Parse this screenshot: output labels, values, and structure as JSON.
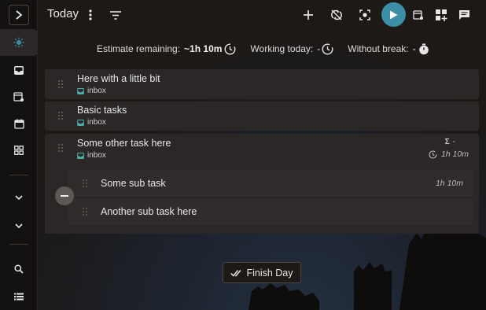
{
  "header": {
    "title": "Today",
    "icons": [
      "more-vertical-icon",
      "filter-icon",
      "add-icon",
      "sync-disabled-icon",
      "focus-mode-icon",
      "play-icon",
      "schedule-icon",
      "add-widget-icon",
      "notes-icon"
    ],
    "accent_color": "#3b8ea5"
  },
  "sidebar": {
    "items": [
      {
        "name": "today",
        "icon": "sun-icon",
        "active": true
      },
      {
        "name": "inbox",
        "icon": "inbox-icon"
      },
      {
        "name": "schedule",
        "icon": "calendar-sun-icon"
      },
      {
        "name": "planner",
        "icon": "calendar-icon"
      },
      {
        "name": "boards",
        "icon": "grid-icon"
      },
      {
        "name": "projects",
        "icon": "chevron-down-icon"
      },
      {
        "name": "tags",
        "icon": "chevron-down-icon"
      },
      {
        "name": "search",
        "icon": "search-icon"
      },
      {
        "name": "all-tasks",
        "icon": "list-icon"
      }
    ]
  },
  "metrics": {
    "estimate_label": "Estimate remaining:",
    "estimate_value": "~1h 10m",
    "working_label": "Working today:",
    "working_value": "-",
    "break_label": "Without break:",
    "break_value": "-"
  },
  "tasks": [
    {
      "title": "Here with a little bit",
      "tag": "inbox"
    },
    {
      "title": "Basic tasks",
      "tag": "inbox"
    },
    {
      "title": "Some other task here",
      "tag": "inbox",
      "sum_symbol": "Σ",
      "sum_value": "-",
      "time_estimate": "1h 10m",
      "subtasks": [
        {
          "title": "Some sub task",
          "time": "1h 10m"
        },
        {
          "title": "Another sub task here",
          "time": ""
        }
      ]
    }
  ],
  "footer": {
    "finish_label": "Finish Day"
  }
}
